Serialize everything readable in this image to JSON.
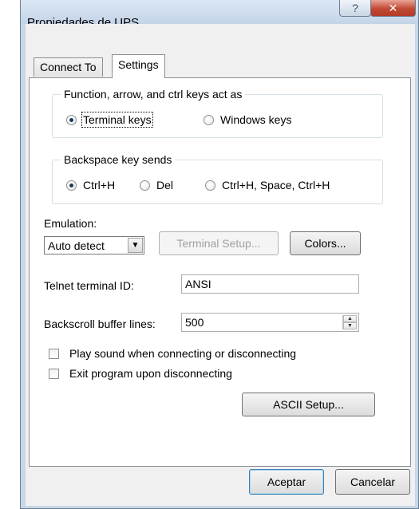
{
  "window": {
    "title": "Propiedades de UPS",
    "help_glyph": "?",
    "close_glyph": "✕"
  },
  "tabs": [
    {
      "label": "Connect To",
      "selected": false
    },
    {
      "label": "Settings",
      "selected": true
    }
  ],
  "keys_group": {
    "title": "Function, arrow, and ctrl keys act as",
    "options": [
      {
        "label": "Terminal keys",
        "checked": true
      },
      {
        "label": "Windows keys",
        "checked": false
      }
    ]
  },
  "backspace_group": {
    "title": "Backspace key sends",
    "options": [
      {
        "label": "Ctrl+H",
        "checked": true
      },
      {
        "label": "Del",
        "checked": false
      },
      {
        "label": "Ctrl+H, Space, Ctrl+H",
        "checked": false
      }
    ]
  },
  "emulation": {
    "label": "Emulation:",
    "selected": "Auto detect",
    "terminal_setup_label": "Terminal Setup...",
    "colors_label": "Colors..."
  },
  "telnet": {
    "label": "Telnet terminal ID:",
    "value": "ANSI"
  },
  "backscroll": {
    "label": "Backscroll buffer lines:",
    "value": "500"
  },
  "checkboxes": [
    {
      "label": "Play sound when connecting or disconnecting",
      "checked": false
    },
    {
      "label": "Exit program upon disconnecting",
      "checked": false
    }
  ],
  "ascii_setup_label": "ASCII Setup...",
  "footer": {
    "ok_label": "Aceptar",
    "cancel_label": "Cancelar"
  }
}
